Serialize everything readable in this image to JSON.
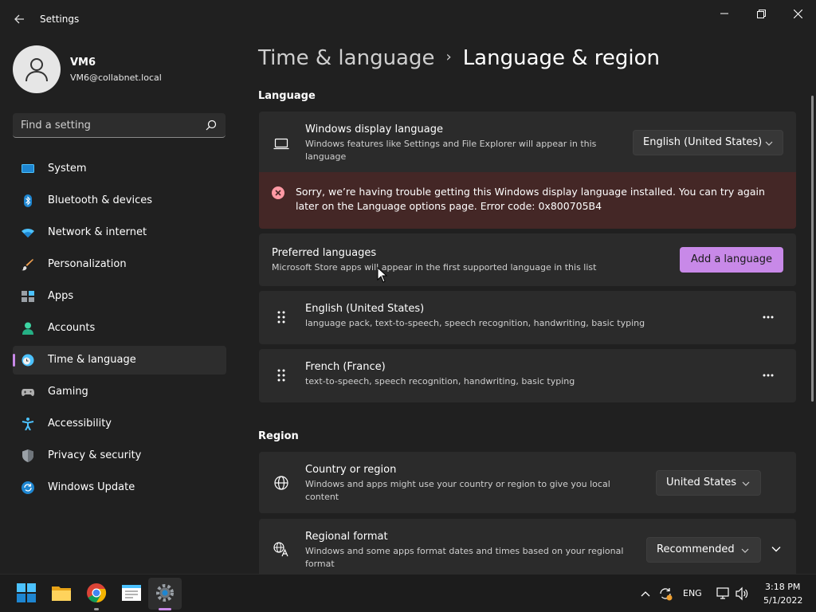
{
  "window": {
    "title": "Settings"
  },
  "profile": {
    "name": "VM6",
    "email": "VM6@collabnet.local"
  },
  "search": {
    "placeholder": "Find a setting"
  },
  "sidebar": {
    "items": [
      {
        "label": "System",
        "icon": "monitor-icon",
        "active": false
      },
      {
        "label": "Bluetooth & devices",
        "icon": "bluetooth-icon",
        "active": false
      },
      {
        "label": "Network & internet",
        "icon": "wifi-icon",
        "active": false
      },
      {
        "label": "Personalization",
        "icon": "brush-icon",
        "active": false
      },
      {
        "label": "Apps",
        "icon": "apps-icon",
        "active": false
      },
      {
        "label": "Accounts",
        "icon": "person-icon",
        "active": false
      },
      {
        "label": "Time & language",
        "icon": "globe-clock-icon",
        "active": true
      },
      {
        "label": "Gaming",
        "icon": "gamepad-icon",
        "active": false
      },
      {
        "label": "Accessibility",
        "icon": "accessibility-icon",
        "active": false
      },
      {
        "label": "Privacy & security",
        "icon": "shield-icon",
        "active": false
      },
      {
        "label": "Windows Update",
        "icon": "update-icon",
        "active": false
      }
    ]
  },
  "breadcrumb": {
    "parent": "Time & language",
    "separator": "›",
    "current": "Language & region"
  },
  "language": {
    "section_title": "Language",
    "display_language": {
      "title": "Windows display language",
      "description": "Windows features like Settings and File Explorer will appear in this language",
      "value": "English (United States)"
    },
    "error": {
      "message": "Sorry, we’re having trouble getting this Windows display language installed. You can try again later on the Language options page. Error code: 0x800705B4"
    },
    "preferred": {
      "title": "Preferred languages",
      "description": "Microsoft Store apps will appear in the first supported language in this list",
      "button": "Add a language"
    },
    "languages": [
      {
        "name": "English (United States)",
        "features": "language pack, text-to-speech, speech recognition, handwriting, basic typing"
      },
      {
        "name": "French (France)",
        "features": "text-to-speech, speech recognition, handwriting, basic typing"
      }
    ]
  },
  "region": {
    "section_title": "Region",
    "country": {
      "title": "Country or region",
      "description": "Windows and apps might use your country or region to give you local content",
      "value": "United States"
    },
    "format": {
      "title": "Regional format",
      "description": "Windows and some apps format dates and times based on your regional format",
      "value": "Recommended"
    }
  },
  "taskbar": {
    "apps": [
      "start-icon",
      "file-explorer-icon",
      "chrome-icon",
      "notepad-icon",
      "settings-icon"
    ],
    "tray": {
      "language": "ENG",
      "time": "3:18 PM",
      "date": "5/1/2022"
    }
  },
  "colors": {
    "accent": "#c889e8",
    "background": "#202020",
    "card": "#2b2b2b",
    "error_bg": "#442726",
    "error_icon": "#ff99a4"
  }
}
